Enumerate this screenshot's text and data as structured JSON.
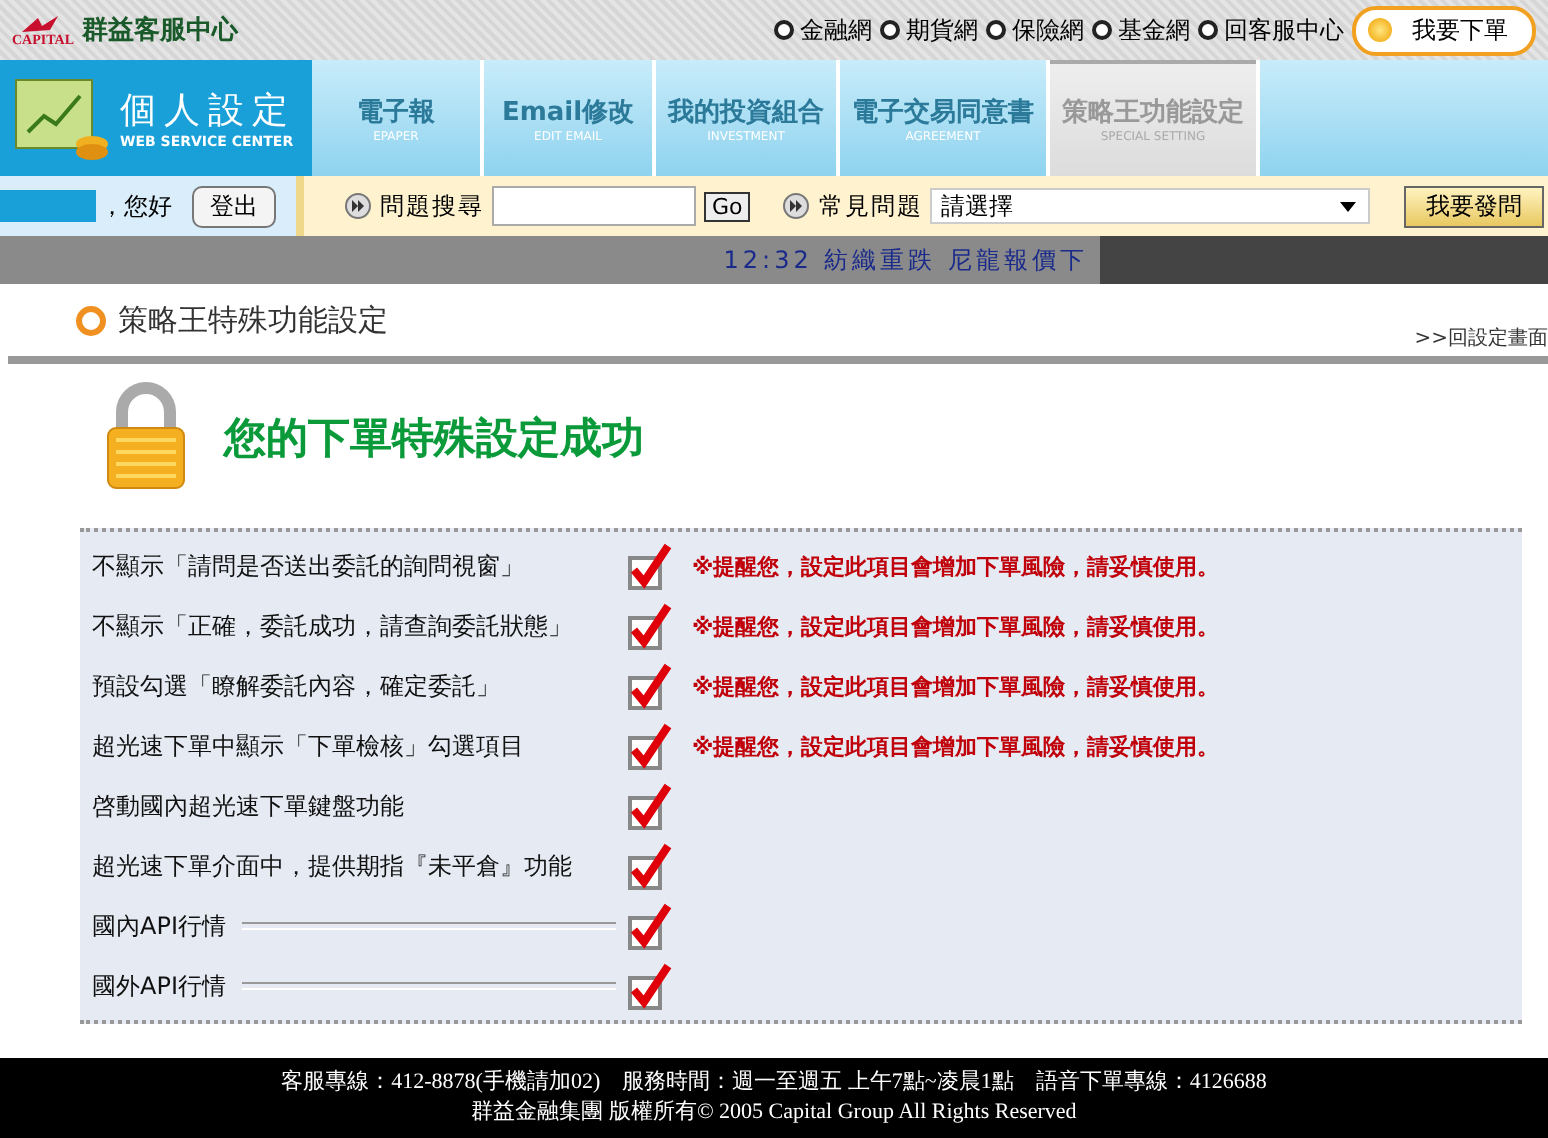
{
  "header": {
    "logo_text": "CAPITAL",
    "brand": "群益客服中心",
    "links": [
      "金融網",
      "期貨網",
      "保險網",
      "基金網",
      "回客服中心"
    ],
    "order_button": "我要下單"
  },
  "nav": {
    "title": "個人設定",
    "subtitle": "WEB SERVICE CENTER",
    "tabs": [
      {
        "label": "電子報",
        "sub": "EPAPER",
        "selected": false
      },
      {
        "label": "Email修改",
        "sub": "EDIT EMAIL",
        "selected": false
      },
      {
        "label": "我的投資組合",
        "sub": "INVESTMENT",
        "selected": false
      },
      {
        "label": "電子交易同意書",
        "sub": "AGREEMENT",
        "selected": false
      },
      {
        "label": "策略王功能設定",
        "sub": "SPECIAL SETTING",
        "selected": true
      }
    ]
  },
  "toolbar": {
    "greeting": "，您好",
    "logout": "登出",
    "search_label": "問題搜尋",
    "go": "Go",
    "faq_label": "常見問題",
    "faq_value": "請選擇",
    "ask": "我要發問"
  },
  "ticker": "12:32 紡織重跌 尼龍報價下",
  "section": {
    "title": "策略王特殊功能設定",
    "back_link": ">>回設定畫面"
  },
  "success": "您的下單特殊設定成功",
  "settings": [
    {
      "kind": "plain",
      "label": "不顯示「請問是否送出委託的詢問視窗」",
      "checked": true,
      "warning": "※提醒您，設定此項目會增加下單風險，請妥慎使用。"
    },
    {
      "kind": "plain",
      "label": "不顯示「正確，委託成功，請查詢委託狀態」",
      "checked": true,
      "warning": "※提醒您，設定此項目會增加下單風險，請妥慎使用。"
    },
    {
      "kind": "plain",
      "label": "預設勾選「瞭解委託內容，確定委託」",
      "checked": true,
      "warning": "※提醒您，設定此項目會增加下單風險，請妥慎使用。"
    },
    {
      "kind": "plain",
      "label": "超光速下單中顯示「下單檢核」勾選項目",
      "checked": true,
      "warning": "※提醒您，設定此項目會增加下單風險，請妥慎使用。"
    },
    {
      "kind": "plain",
      "label": "啓動國內超光速下單鍵盤功能",
      "checked": true
    },
    {
      "kind": "plain",
      "label": "超光速下單介面中，提供期指『未平倉』功能",
      "checked": true
    },
    {
      "kind": "line",
      "label": "國內API行情",
      "checked": true
    },
    {
      "kind": "line",
      "label": "國外API行情",
      "checked": true
    }
  ],
  "footer": [
    "客服專線：412-8878(手機請加02)　服務時間：週一至週五 上午7點~凌晨1點　語音下單專線：4126688",
    "群益金融集團 版權所有© 2005 Capital Group All Rights Reserved"
  ]
}
